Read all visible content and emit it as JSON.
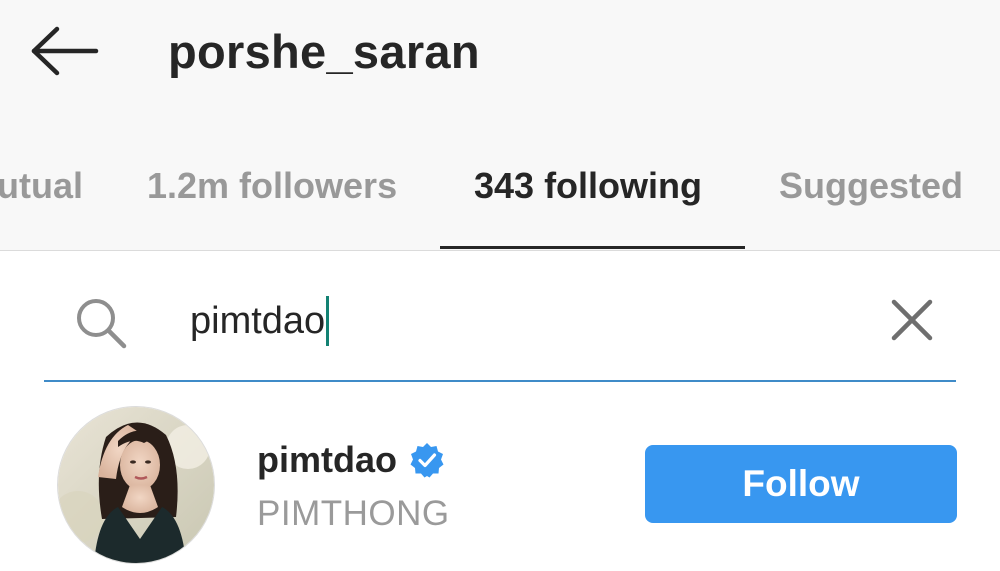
{
  "header": {
    "title": "porshe_saran",
    "back_icon": "back-arrow-icon"
  },
  "tabs": [
    {
      "label": "utual",
      "active": false
    },
    {
      "label": "1.2m followers",
      "active": false
    },
    {
      "label": "343 following",
      "active": true
    },
    {
      "label": "Suggested",
      "active": false
    }
  ],
  "search": {
    "value": "pimtdao",
    "search_icon": "search-icon",
    "clear_icon": "close-icon",
    "caret_color": "#138273",
    "underline_color": "#3f8bc8"
  },
  "results": [
    {
      "username": "pimtdao",
      "verified": true,
      "full_name": "PIMTHONG",
      "button_label": "Follow"
    }
  ],
  "colors": {
    "accent": "#3897f0",
    "verified": "#3897f0",
    "text_primary": "#262626",
    "text_secondary": "#999999"
  }
}
